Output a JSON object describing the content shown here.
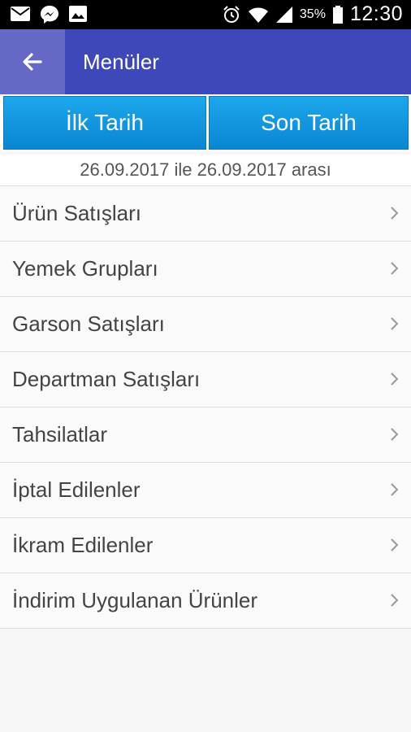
{
  "status_bar": {
    "icons": [
      "mail-icon",
      "messenger-icon",
      "image-icon",
      "alarm-icon",
      "wifi-icon",
      "signal-icon",
      "battery-icon"
    ],
    "battery": "35%",
    "time": "12:30"
  },
  "app_bar": {
    "title": "Menüler"
  },
  "date_buttons": {
    "start": "İlk Tarih",
    "end": "Son Tarih"
  },
  "range_text": "26.09.2017 ile 26.09.2017 arası",
  "menu": {
    "items": [
      {
        "label": "Ürün Satışları"
      },
      {
        "label": "Yemek Grupları"
      },
      {
        "label": "Garson Satışları"
      },
      {
        "label": "Departman Satışları"
      },
      {
        "label": "Tahsilatlar"
      },
      {
        "label": "İptal Edilenler"
      },
      {
        "label": "İkram Edilenler"
      },
      {
        "label": "İndirim Uygulanan Ürünler"
      }
    ]
  },
  "colors": {
    "app_bar": "#3f48b8",
    "back_button": "#6568c5",
    "date_button": "#1da7ec"
  }
}
